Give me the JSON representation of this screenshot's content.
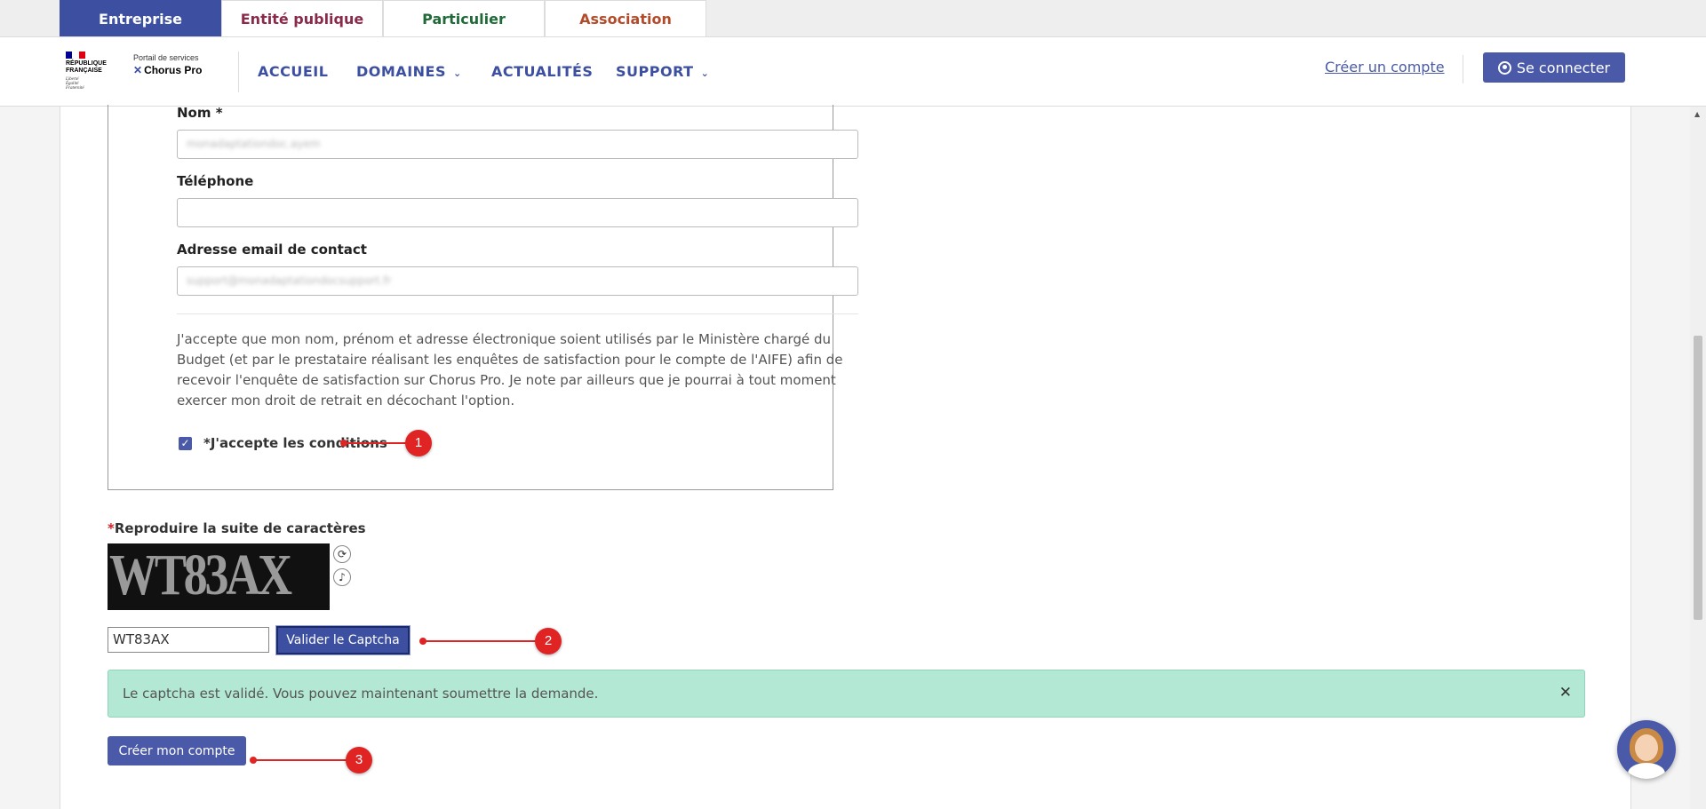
{
  "audience_tabs": [
    {
      "label": "Entreprise",
      "active": true
    },
    {
      "label": "Entité publique"
    },
    {
      "label": "Particulier"
    },
    {
      "label": "Association"
    }
  ],
  "header": {
    "logo": {
      "rf_line1": "RÉPUBLIQUE",
      "rf_line2": "FRANÇAISE",
      "motto1": "Liberté",
      "motto2": "Égalité",
      "motto3": "Fraternité",
      "portal_label": "Portail de services",
      "portal_name": "Chorus Pro"
    },
    "nav": [
      {
        "label": "ACCUEIL"
      },
      {
        "label": "DOMAINES",
        "dropdown": true
      },
      {
        "label": "ACTUALITÉS"
      },
      {
        "label": "SUPPORT",
        "dropdown": true
      }
    ],
    "create_account_link": "Créer un compte",
    "connect_button": "Se connecter"
  },
  "form": {
    "nom_label": "Nom *",
    "nom_value": "monadaptationdoc.ayem",
    "telephone_label": "Téléphone",
    "telephone_value": "",
    "email_label": "Adresse email de contact",
    "email_value": "support@monadaptationdocsupport.fr",
    "consent_text": "J'accepte que mon nom, prénom et adresse électronique soient utilisés par le Ministère chargé du Budget (et par le prestataire réalisant les enquêtes de satisfaction pour le compte de l'AIFE) afin de recevoir l'enquête de satisfaction sur Chorus Pro. Je note par ailleurs que je pourrai à tout moment exercer mon droit de retrait en décochant l'option.",
    "accept_label": "*J'accepte les conditions",
    "accept_checked": true
  },
  "captcha": {
    "required_mark": "*",
    "label": "Reproduire la suite de caractères",
    "image_text": "WT83AX",
    "input_value": "WT83AX",
    "validate_button": "Valider le Captcha",
    "success_message": "Le captcha est validé. Vous pouvez maintenant soumettre la demande.",
    "close_glyph": "✕"
  },
  "submit_button": "Créer mon compte",
  "annotations": [
    "1",
    "2",
    "3"
  ],
  "colors": {
    "primary": "#3d4fa0",
    "success_bg": "#b3e8d4",
    "annotation_red": "#e02424"
  }
}
